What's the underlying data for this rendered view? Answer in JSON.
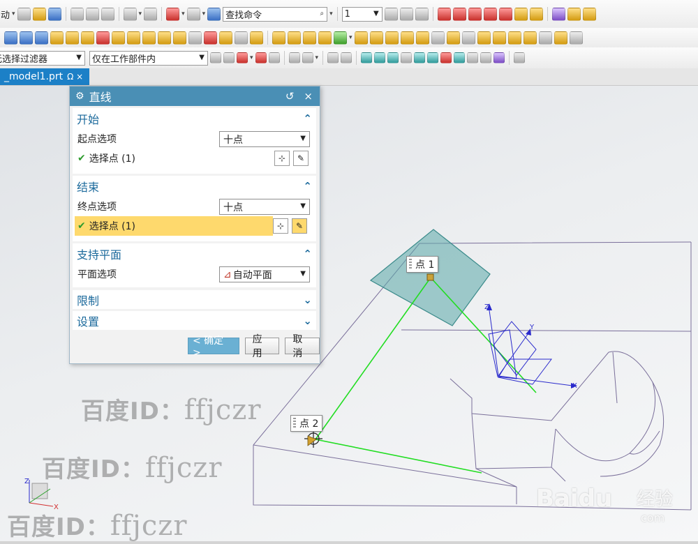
{
  "toolbar": {
    "start_label": "启动",
    "search_placeholder": "查找命令",
    "layer_value": "1",
    "filter_value": "无选择过滤器",
    "scope_value": "仅在工作部件内"
  },
  "tab": {
    "label": "_model1.prt",
    "suffix": "Ω ×"
  },
  "dialog": {
    "title": "直线",
    "reset_glyph": "↺",
    "close_glyph": "×",
    "start": {
      "header": "开始",
      "option_label": "起点选项",
      "option_value": "十点",
      "select_label": "选择点 (1)"
    },
    "end": {
      "header": "结束",
      "option_label": "终点选项",
      "option_value": "十点",
      "select_label": "选择点 (1)"
    },
    "plane": {
      "header": "支持平面",
      "option_label": "平面选项",
      "option_value": "自动平面"
    },
    "limit_header": "限制",
    "settings_header": "设置",
    "ok_label": "< 确定 >",
    "apply_label": "应用",
    "cancel_label": "取消"
  },
  "viewport": {
    "point1_label": "点 1",
    "point2_label": "点 2",
    "axis_x": "X",
    "axis_y": "Y",
    "axis_z": "Z",
    "triad_x": "X",
    "triad_z": "Z"
  },
  "watermark": {
    "prefix": "百度ID：",
    "name": "ffjczr",
    "baidu": "Baidu",
    "jingyan": "经验",
    "com": "com"
  },
  "colors": {
    "title_bar": "#4a8fb5",
    "section_header": "#1c6a9c",
    "highlight": "#fed96d",
    "line_green": "#22dd22",
    "plane": "#5aa7a7",
    "tab_active": "#1c80c7"
  }
}
